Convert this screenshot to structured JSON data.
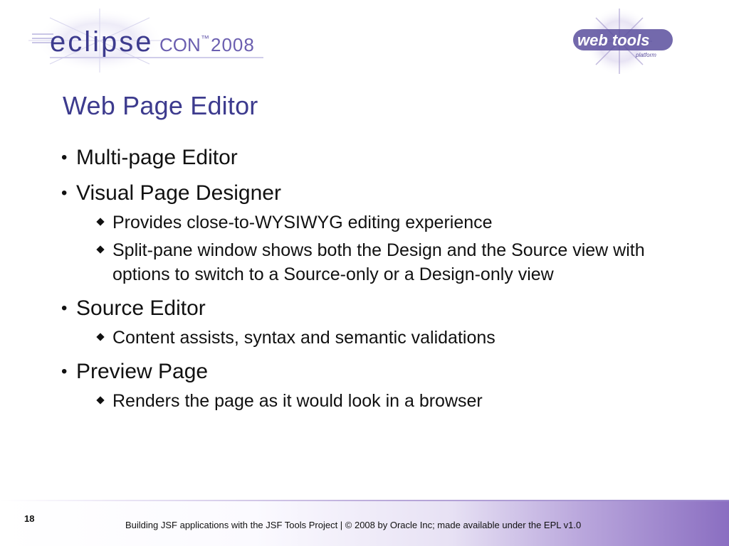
{
  "header": {
    "eclipsecon_logo": {
      "eclipse_text": "eclipse",
      "con_text": "CON",
      "tm": "™",
      "year": "2008"
    },
    "webtools_logo": {
      "main_text": "web tools",
      "sub_text": "platform"
    }
  },
  "slide": {
    "title": "Web Page Editor",
    "bullets": [
      {
        "text": "Multi-page Editor",
        "subs": []
      },
      {
        "text": "Visual Page Designer",
        "subs": [
          "Provides close-to-WYSIWYG editing experience",
          "Split-pane window shows both the Design and the Source view with options to switch to a Source-only or a Design-only view"
        ]
      },
      {
        "text": "Source Editor",
        "subs": [
          "Content assists, syntax and semantic validations"
        ]
      },
      {
        "text": "Preview Page",
        "subs": [
          "Renders the page as it would look in a browser"
        ]
      }
    ]
  },
  "footer": {
    "page_number": "18",
    "text": "Building JSF applications with the JSF Tools Project | © 2008 by Oracle Inc; made available under the EPL v1.0"
  },
  "colors": {
    "title": "#3d3b8e",
    "eclipse_logo": "#3d3b8e",
    "footer_gradient_end": "#8a6ec1"
  }
}
